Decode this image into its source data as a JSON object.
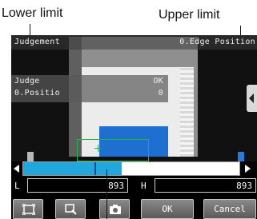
{
  "callouts": {
    "lower_limit": "Lower limit",
    "upper_limit": "Upper limit"
  },
  "header": {
    "title": "Judgement",
    "item": "0.Edge Position"
  },
  "result": {
    "judge_label": "Judge",
    "judge_value": "OK",
    "position_label": "0.Positio",
    "position_value": "0"
  },
  "slider": {
    "fill_fraction": 0.455,
    "marker_fraction": 0.33
  },
  "fields": {
    "lower_label": "L",
    "lower_value": "893",
    "upper_label": "H",
    "upper_value": "893"
  },
  "buttons": {
    "icons": [
      "fit-window-icon",
      "zoom-icon",
      "camera-icon"
    ],
    "ok_label": "OK",
    "cancel_label": "Cancel"
  },
  "colors": {
    "slider_fill": "#22a7dc",
    "target": "#1f6fd1",
    "region": "#22b34a",
    "upper_handle": "#2a7bd8"
  }
}
